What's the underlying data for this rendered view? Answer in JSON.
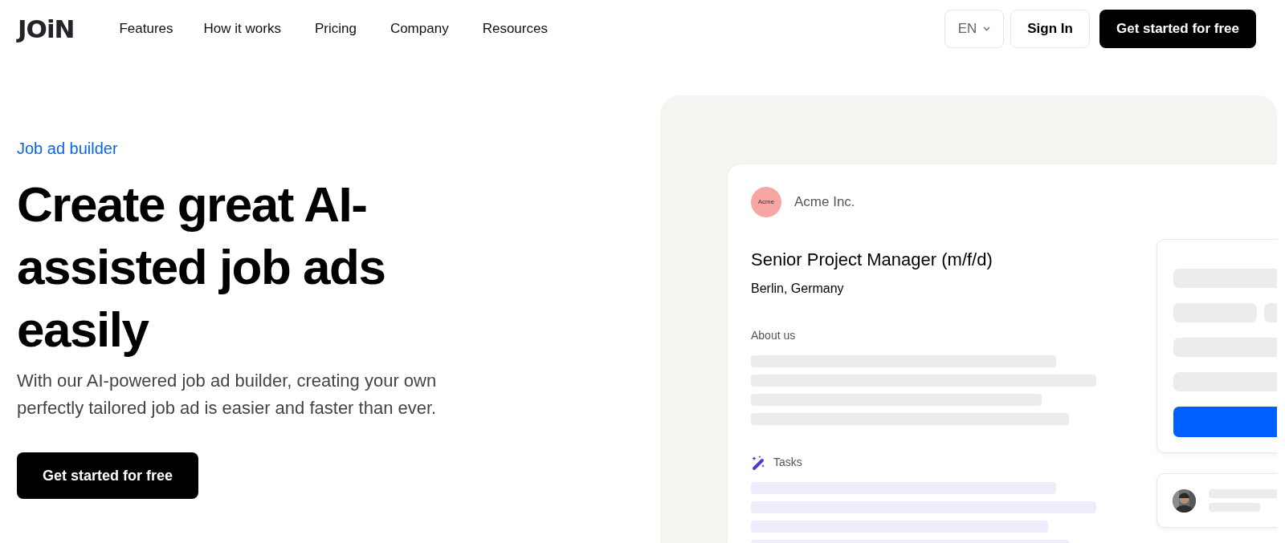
{
  "header": {
    "logo": "JOiN",
    "nav": [
      "Features",
      "How it works",
      "Pricing",
      "Company",
      "Resources"
    ],
    "language": "EN",
    "sign_in": "Sign In",
    "cta": "Get started for free"
  },
  "hero": {
    "eyebrow": "Job ad builder",
    "title": "Create great AI-assisted job ads easily",
    "text": "With our AI-powered job ad builder, creating your own perfectly tailored job ad is easier and faster than ever.",
    "cta": "Get started for free"
  },
  "preview": {
    "company_logo": "Acme",
    "company": "Acme Inc.",
    "job_title": "Senior Project Manager (m/f/d)",
    "location": "Berlin, Germany",
    "sections": [
      {
        "label": "About us",
        "kind": "plain"
      },
      {
        "label": "Tasks",
        "kind": "ai"
      }
    ]
  }
}
